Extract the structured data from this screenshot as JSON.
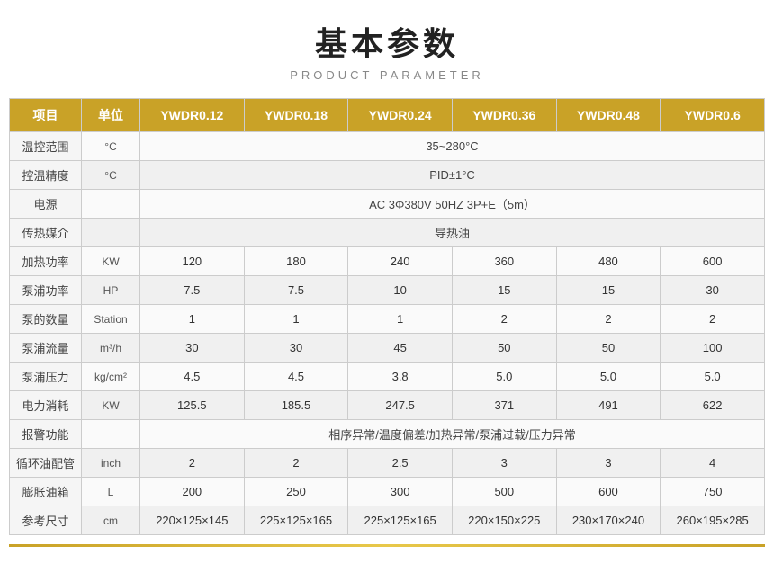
{
  "header": {
    "main_title": "基本参数",
    "sub_title": "PRODUCT PARAMETER"
  },
  "table": {
    "columns": [
      "项目",
      "单位",
      "YWDR0.12",
      "YWDR0.18",
      "YWDR0.24",
      "YWDR0.36",
      "YWDR0.48",
      "YWDR0.6"
    ],
    "rows": [
      {
        "label": "温控范围",
        "unit": "°C",
        "span": true,
        "span_value": "35~280°C",
        "values": []
      },
      {
        "label": "控温精度",
        "unit": "°C",
        "span": true,
        "span_value": "PID±1°C",
        "values": []
      },
      {
        "label": "电源",
        "unit": "",
        "span": true,
        "span_value": "AC 3Φ380V 50HZ 3P+E（5m）",
        "values": []
      },
      {
        "label": "传热媒介",
        "unit": "",
        "span": true,
        "span_value": "导热油",
        "values": []
      },
      {
        "label": "加热功率",
        "unit": "KW",
        "span": false,
        "span_value": "",
        "values": [
          "120",
          "180",
          "240",
          "360",
          "480",
          "600"
        ]
      },
      {
        "label": "泵浦功率",
        "unit": "HP",
        "span": false,
        "span_value": "",
        "values": [
          "7.5",
          "7.5",
          "10",
          "15",
          "15",
          "30"
        ]
      },
      {
        "label": "泵的数量",
        "unit": "Station",
        "span": false,
        "span_value": "",
        "values": [
          "1",
          "1",
          "1",
          "2",
          "2",
          "2"
        ]
      },
      {
        "label": "泵浦流量",
        "unit": "m³/h",
        "span": false,
        "span_value": "",
        "values": [
          "30",
          "30",
          "45",
          "50",
          "50",
          "100"
        ]
      },
      {
        "label": "泵浦压力",
        "unit": "kg/cm²",
        "span": false,
        "span_value": "",
        "values": [
          "4.5",
          "4.5",
          "3.8",
          "5.0",
          "5.0",
          "5.0"
        ]
      },
      {
        "label": "电力消耗",
        "unit": "KW",
        "span": false,
        "span_value": "",
        "values": [
          "125.5",
          "185.5",
          "247.5",
          "371",
          "491",
          "622"
        ]
      },
      {
        "label": "报警功能",
        "unit": "",
        "span": true,
        "span_value": "相序异常/温度偏差/加热异常/泵浦过载/压力异常",
        "values": []
      },
      {
        "label": "循环油配管",
        "unit": "inch",
        "span": false,
        "span_value": "",
        "values": [
          "2",
          "2",
          "2.5",
          "3",
          "3",
          "4"
        ]
      },
      {
        "label": "膨胀油箱",
        "unit": "L",
        "span": false,
        "span_value": "",
        "values": [
          "200",
          "250",
          "300",
          "500",
          "600",
          "750"
        ]
      },
      {
        "label": "参考尺寸",
        "unit": "cm",
        "span": false,
        "span_value": "",
        "values": [
          "220×125×145",
          "225×125×165",
          "225×125×165",
          "220×150×225",
          "230×170×240",
          "260×195×285"
        ]
      }
    ]
  }
}
